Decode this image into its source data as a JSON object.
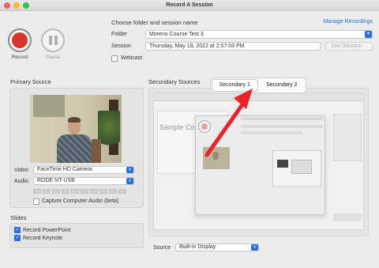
{
  "window": {
    "title": "Record A Session"
  },
  "controls": {
    "record_label": "Record",
    "pause_label": "Pause"
  },
  "session": {
    "heading": "Choose folder and session name",
    "manage_link": "Manage Recordings",
    "folder_label": "Folder",
    "folder_value": "Moreno Course Test 3",
    "session_label": "Session",
    "session_value": "Thursday, May 19, 2022 at 2:57:03 PM",
    "join_button": "Join Session",
    "webcast_label": "Webcast"
  },
  "primary": {
    "heading": "Primary Source",
    "video_label": "Video",
    "video_value": "FaceTime HD Camera",
    "audio_label": "Audio",
    "audio_value": "RODE NT-USB",
    "capture_audio_label": "Capture Computer Audio (beta)"
  },
  "slides": {
    "heading": "Slides",
    "items": [
      {
        "label": "Record PowerPoint",
        "checked": true
      },
      {
        "label": "Record Keynote",
        "checked": true
      }
    ]
  },
  "secondary": {
    "heading": "Secondary Sources",
    "tabs": [
      {
        "label": "Secondary 1",
        "active": true
      },
      {
        "label": "Secondary 2",
        "active": false
      }
    ],
    "preview_title": "Sample Course",
    "source_label": "Source",
    "source_value": "Built-in Display"
  },
  "colors": {
    "accent": "#2a6fdb",
    "record": "#d9362d",
    "link": "#2a6fc9",
    "annotation_arrow": "#e8242b"
  },
  "icons": {
    "select_arrow": "chevron-updown-icon",
    "checkmark": "checkmark-icon"
  }
}
